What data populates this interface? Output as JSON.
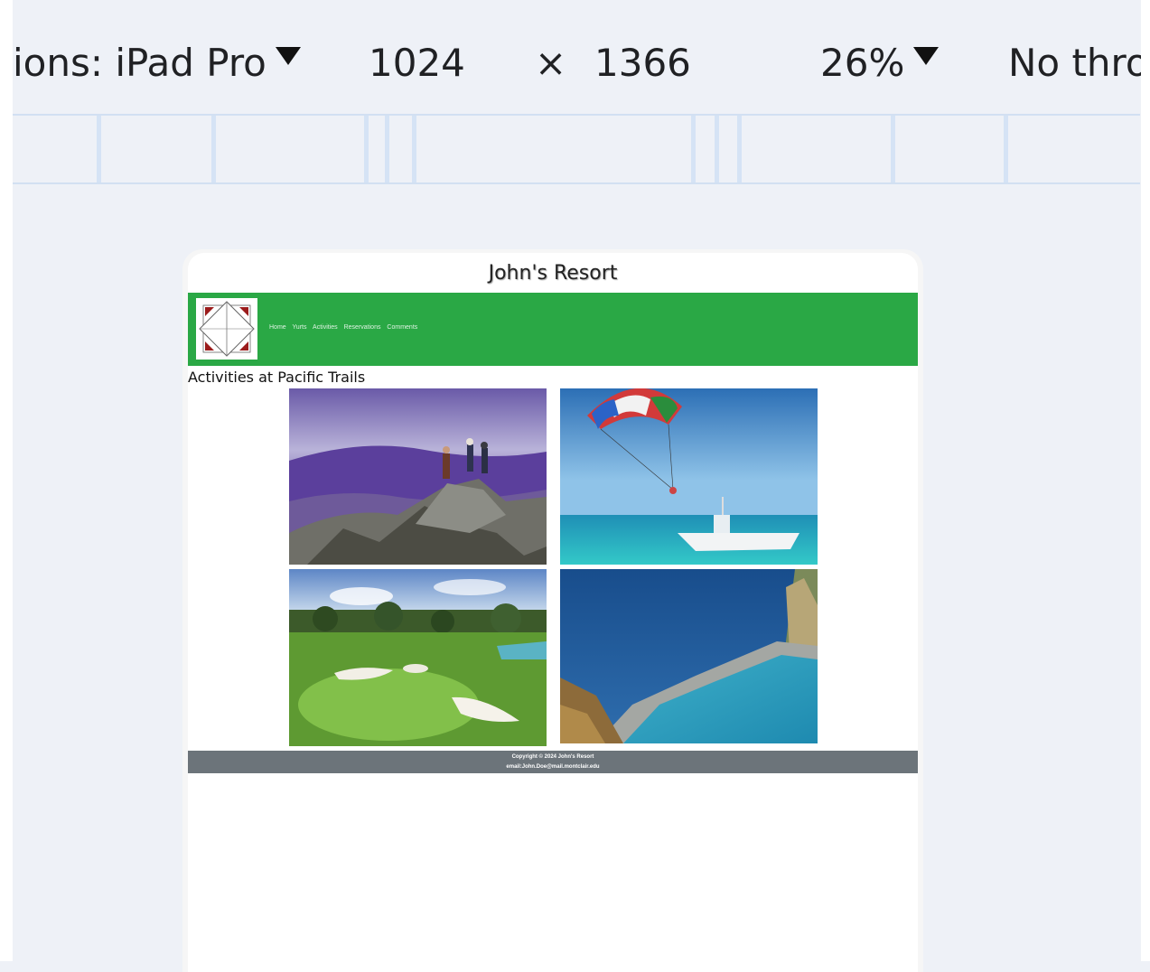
{
  "devtools": {
    "dimensions_label": "ions: iPad Pro",
    "width": "1024",
    "times": "×",
    "height": "1366",
    "zoom": "26%",
    "throttle": "No thro"
  },
  "site": {
    "title": "John's Resort",
    "nav": [
      "Home",
      "Yurts",
      "Activities",
      "Reservations",
      "Comments"
    ],
    "heading": "Activities at Pacific Trails",
    "photos": [
      {
        "name": "hiking-photo"
      },
      {
        "name": "parasailing-photo"
      },
      {
        "name": "golf-photo"
      },
      {
        "name": "pool-photo"
      }
    ],
    "footer": {
      "copyright": "Copyright © 2024 John's Resort",
      "email": "email:John.Doe@mail.montclair.edu"
    }
  },
  "colors": {
    "nav_green": "#2aa845",
    "footer_gray": "#6c747a",
    "logo_red": "#9b1c1c"
  }
}
